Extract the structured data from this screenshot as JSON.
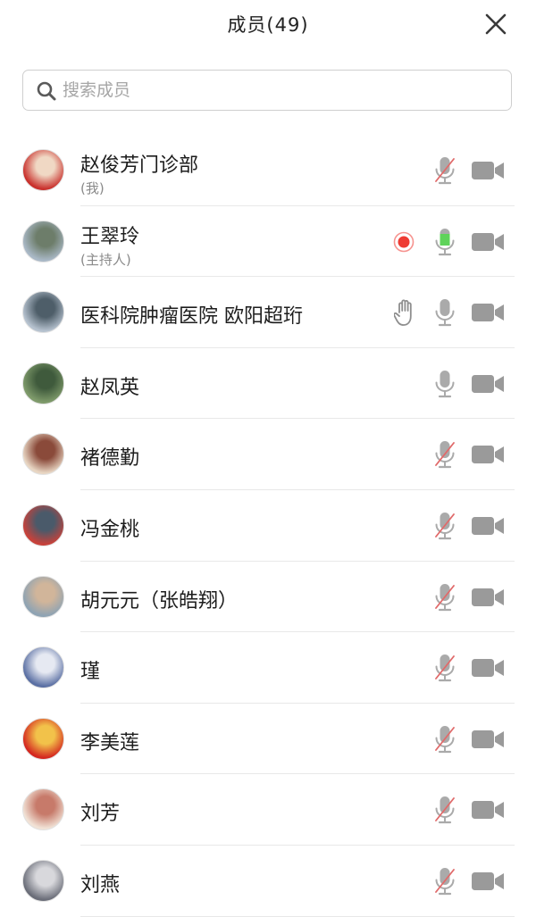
{
  "header": {
    "title": "成员(49)",
    "close_icon": "close-icon"
  },
  "search": {
    "placeholder": "搜索成员",
    "value": "",
    "icon": "search-icon"
  },
  "colors": {
    "mic_active": "#5fd35a",
    "mic_icon": "#aaaaaa",
    "mic_slash": "#e06a6a",
    "camera_icon": "#9a9a9a",
    "record_red": "#ee3b33",
    "hand_icon": "#8e8e8e"
  },
  "members": [
    {
      "name": "赵俊芳门诊部",
      "subtitle": "(我)",
      "mic": "muted",
      "camera": "camera-icon",
      "extra": "",
      "avatar_colors": [
        "#c9302c",
        "#f0d8c4"
      ]
    },
    {
      "name": "王翠玲",
      "subtitle": "(主持人)",
      "mic": "active",
      "camera": "camera-icon",
      "extra": "recording",
      "avatar_colors": [
        "#a9b8c6",
        "#6d7d6a"
      ]
    },
    {
      "name": "医科院肿瘤医院 欧阳超珩",
      "subtitle": "",
      "mic": "on",
      "camera": "camera-icon",
      "extra": "hand-raised",
      "avatar_colors": [
        "#b6c2cf",
        "#4e5e69"
      ]
    },
    {
      "name": "赵凤英",
      "subtitle": "",
      "mic": "on",
      "camera": "camera-icon",
      "extra": "",
      "avatar_colors": [
        "#7f9b6b",
        "#3f5a3c"
      ]
    },
    {
      "name": "褚德勤",
      "subtitle": "",
      "mic": "muted",
      "camera": "camera-icon",
      "extra": "",
      "avatar_colors": [
        "#e8d6c3",
        "#8a4a3a"
      ]
    },
    {
      "name": "冯金桃",
      "subtitle": "",
      "mic": "muted",
      "camera": "camera-icon",
      "extra": "",
      "avatar_colors": [
        "#c8413a",
        "#4a5a6a"
      ]
    },
    {
      "name": "胡元元（张皓翔）",
      "subtitle": "",
      "mic": "muted",
      "camera": "camera-icon",
      "extra": "",
      "avatar_colors": [
        "#8ea3b3",
        "#d1b59a"
      ]
    },
    {
      "name": "瑾",
      "subtitle": "",
      "mic": "muted",
      "camera": "camera-icon",
      "extra": "",
      "avatar_colors": [
        "#5a6fa3",
        "#e6e9f2"
      ]
    },
    {
      "name": "李美莲",
      "subtitle": "",
      "mic": "muted",
      "camera": "camera-icon",
      "extra": "",
      "avatar_colors": [
        "#d4271f",
        "#f2c24a"
      ]
    },
    {
      "name": "刘芳",
      "subtitle": "",
      "mic": "muted",
      "camera": "camera-icon",
      "extra": "",
      "avatar_colors": [
        "#f1e2d6",
        "#c77a6a"
      ]
    },
    {
      "name": "刘燕",
      "subtitle": "",
      "mic": "muted",
      "camera": "camera-icon",
      "extra": "",
      "avatar_colors": [
        "#6a6d78",
        "#d8d8dc"
      ]
    }
  ]
}
